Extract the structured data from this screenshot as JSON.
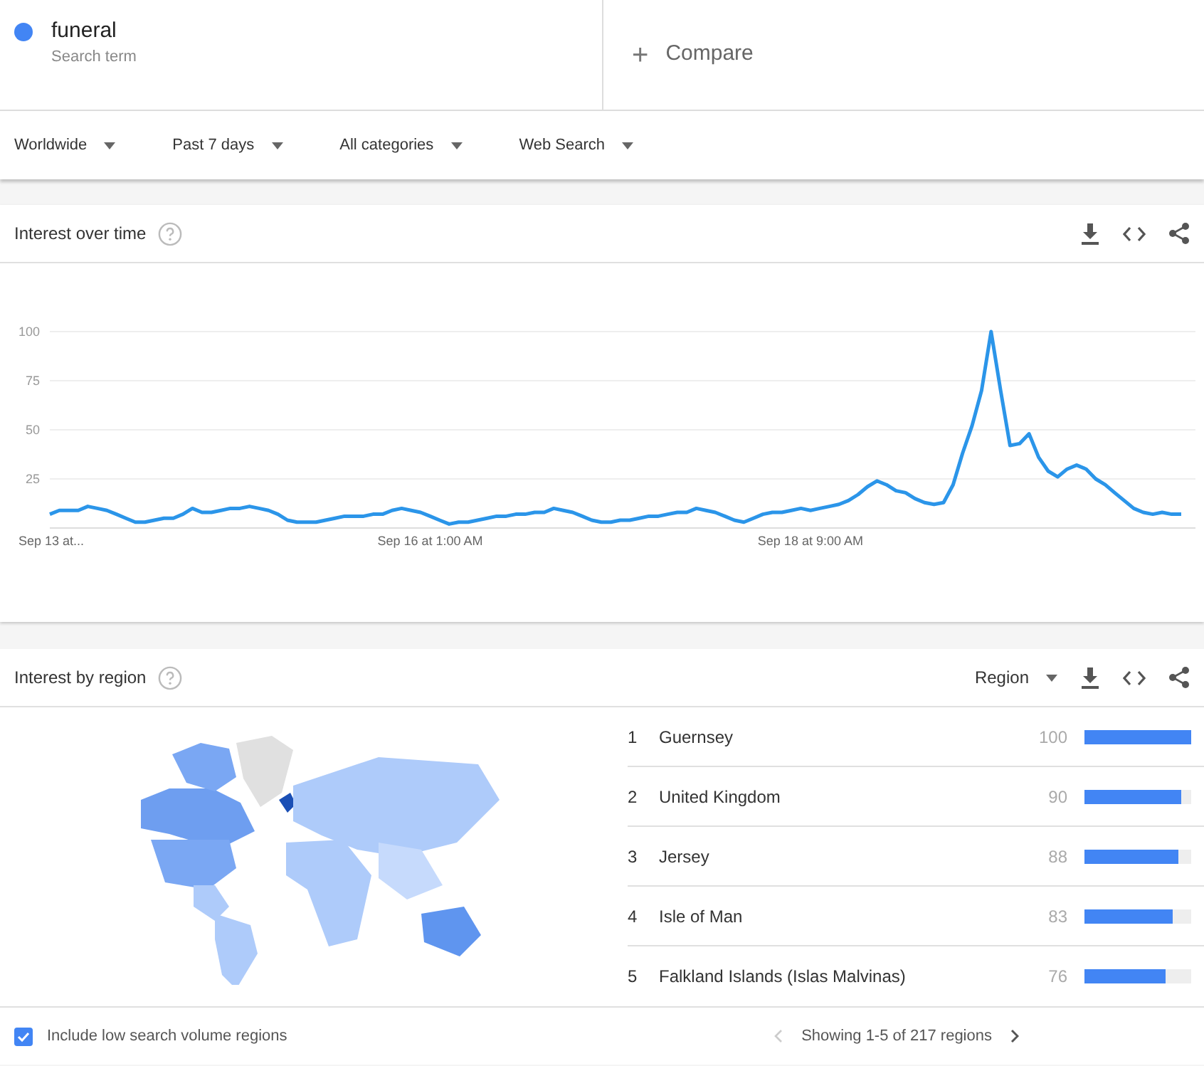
{
  "search_term": {
    "term": "funeral",
    "subtitle": "Search term",
    "color": "#4285f4"
  },
  "compare": {
    "icon": "+",
    "label": "Compare"
  },
  "filters": [
    {
      "label": "Worldwide"
    },
    {
      "label": "Past 7 days"
    },
    {
      "label": "All categories"
    },
    {
      "label": "Web Search"
    }
  ],
  "interest_over_time": {
    "title": "Interest over time",
    "chart_data": {
      "type": "line",
      "categories": [
        "Sep 13 at...",
        null,
        null,
        null,
        null,
        null,
        null,
        null,
        null,
        null,
        null,
        null,
        null,
        null,
        null,
        null,
        null,
        null,
        null,
        null,
        null,
        null,
        null,
        null,
        null,
        null,
        null,
        null,
        null,
        null,
        null,
        null,
        null,
        null,
        null,
        null,
        null,
        null,
        null,
        null,
        "Sep 16 at 1:00 AM",
        null,
        null,
        null,
        null,
        null,
        null,
        null,
        null,
        null,
        null,
        null,
        null,
        null,
        null,
        null,
        null,
        null,
        null,
        null,
        null,
        null,
        null,
        null,
        null,
        null,
        null,
        null,
        null,
        null,
        null,
        null,
        null,
        null,
        null,
        null,
        null,
        null,
        null,
        null,
        "Sep 18 at 9:00 AM",
        null,
        null,
        null,
        null,
        null,
        null,
        null,
        null,
        null,
        null,
        null,
        null,
        null,
        null,
        null,
        null,
        null,
        null,
        null,
        null,
        null,
        null,
        null,
        null,
        null,
        null,
        null,
        null,
        null,
        null,
        null,
        null,
        null,
        null,
        null,
        null,
        null,
        null,
        null
      ],
      "series": [
        {
          "color": "#2b95e9",
          "values": [
            7,
            9,
            9,
            9,
            11,
            10,
            9,
            7,
            5,
            3,
            3,
            4,
            5,
            5,
            7,
            10,
            8,
            8,
            9,
            10,
            10,
            11,
            10,
            9,
            7,
            4,
            3,
            3,
            3,
            4,
            5,
            6,
            6,
            6,
            7,
            7,
            9,
            10,
            9,
            8,
            6,
            4,
            2,
            3,
            3,
            4,
            5,
            6,
            6,
            7,
            7,
            8,
            8,
            10,
            9,
            8,
            6,
            4,
            3,
            3,
            4,
            4,
            5,
            6,
            6,
            7,
            8,
            8,
            10,
            9,
            8,
            6,
            4,
            3,
            5,
            7,
            8,
            8,
            9,
            10,
            9,
            10,
            11,
            12,
            14,
            17,
            21,
            24,
            22,
            19,
            18,
            15,
            13,
            12,
            13,
            22,
            38,
            52,
            70,
            100,
            70,
            42,
            43,
            48,
            36,
            29,
            26,
            30,
            32,
            30,
            25,
            22,
            18,
            14,
            10,
            8,
            7,
            8,
            7,
            7
          ]
        }
      ],
      "grid": true,
      "ylim": [
        0,
        100
      ],
      "yticks": [
        25,
        50,
        75,
        100
      ]
    }
  },
  "interest_by_region": {
    "title": "Interest by region",
    "resolution": "Region",
    "regions": [
      {
        "rank": "1",
        "name": "Guernsey",
        "value": "100",
        "level": 1.0
      },
      {
        "rank": "2",
        "name": "United Kingdom",
        "value": "90",
        "level": 0.9
      },
      {
        "rank": "3",
        "name": "Jersey",
        "value": "88",
        "level": 0.88
      },
      {
        "rank": "4",
        "name": "Isle of Man",
        "value": "83",
        "level": 0.83
      },
      {
        "rank": "5",
        "name": "Falkland Islands (Islas Malvinas)",
        "value": "76",
        "level": 0.76
      }
    ],
    "include_low_volume": {
      "label": "Include low search volume regions",
      "checked": true
    },
    "pagination": "Showing 1-5 of 217 regions"
  }
}
